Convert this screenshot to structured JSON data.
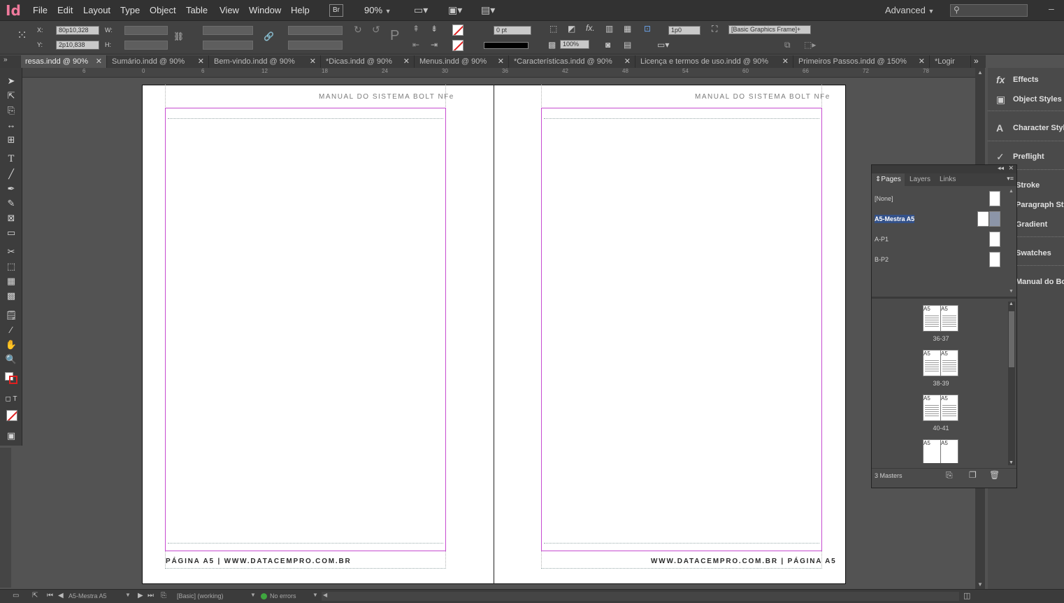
{
  "menubar": {
    "logo": "Id",
    "items": [
      "File",
      "Edit",
      "Layout",
      "Type",
      "Object",
      "Table",
      "View",
      "Window",
      "Help"
    ],
    "bridge_label": "Br",
    "zoom": "90%",
    "workspace": "Advanced"
  },
  "control": {
    "x_label": "X:",
    "y_label": "Y:",
    "w_label": "W:",
    "h_label": "H:",
    "x_value": "80p10,328",
    "y_value": "2p10,838",
    "stroke_weight": "0 pt",
    "opacity": "100%",
    "frame_size": "1p0",
    "object_style": "[Basic Graphics Frame]+"
  },
  "tabs": [
    {
      "label": "resas.indd @ 90%",
      "active": true
    },
    {
      "label": "Sumário.indd @ 90%",
      "active": false
    },
    {
      "label": "Bem-vindo.indd @ 90%",
      "active": false
    },
    {
      "label": "*Dicas.indd @ 90%",
      "active": false
    },
    {
      "label": "Menus.indd @ 90%",
      "active": false
    },
    {
      "label": "*Características.indd @ 90%",
      "active": false
    },
    {
      "label": "Licença e termos de uso.indd @ 90%",
      "active": false
    },
    {
      "label": "Primeiros Passos.indd @ 150%",
      "active": false
    },
    {
      "label": "*Logir",
      "active": false
    }
  ],
  "ruler_top": [
    "6",
    "0",
    "6",
    "12",
    "18",
    "24",
    "30",
    "36",
    "42",
    "48",
    "54",
    "60",
    "66",
    "72",
    "78"
  ],
  "spread": {
    "left_header": "MANUAL DO SISTEMA BOLT NFe",
    "right_header": "MANUAL DO SISTEMA BOLT NFe",
    "left_footer": "PÁGINA A5 | WWW.DATACEMPRO.COM.BR",
    "right_footer": "WWW.DATACEMPRO.COM.BR | PÁGINA A5"
  },
  "panel_strip": [
    {
      "label": "Effects",
      "icon": "fx"
    },
    {
      "label": "Object Styles",
      "icon": "▣"
    },
    {
      "label": "Character Styles",
      "icon": "A"
    },
    {
      "label": "Preflight",
      "icon": "✓"
    },
    {
      "label": "Stroke",
      "icon": ""
    },
    {
      "label": "Paragraph Styles",
      "icon": ""
    },
    {
      "label": "Gradient",
      "icon": ""
    },
    {
      "label": "Swatches",
      "icon": ""
    },
    {
      "label": "Manual do Bolt",
      "icon": ""
    }
  ],
  "pages_panel": {
    "tabs": [
      "Pages",
      "Layers",
      "Links"
    ],
    "masters": [
      "[None]",
      "A5-Mestra A5",
      "A-P1",
      "B-P2"
    ],
    "spreads": [
      {
        "label": "36-37",
        "left": "A5",
        "right": "A5"
      },
      {
        "label": "38-39",
        "left": "A5",
        "right": "A5"
      },
      {
        "label": "40-41",
        "left": "A5",
        "right": "A5"
      },
      {
        "label": "",
        "left": "A5",
        "right": "A5"
      }
    ],
    "footer": "3 Masters"
  },
  "statusbar": {
    "page": "A5-Mestra A5",
    "profile": "[Basic] (working)",
    "errors": "No errors"
  }
}
